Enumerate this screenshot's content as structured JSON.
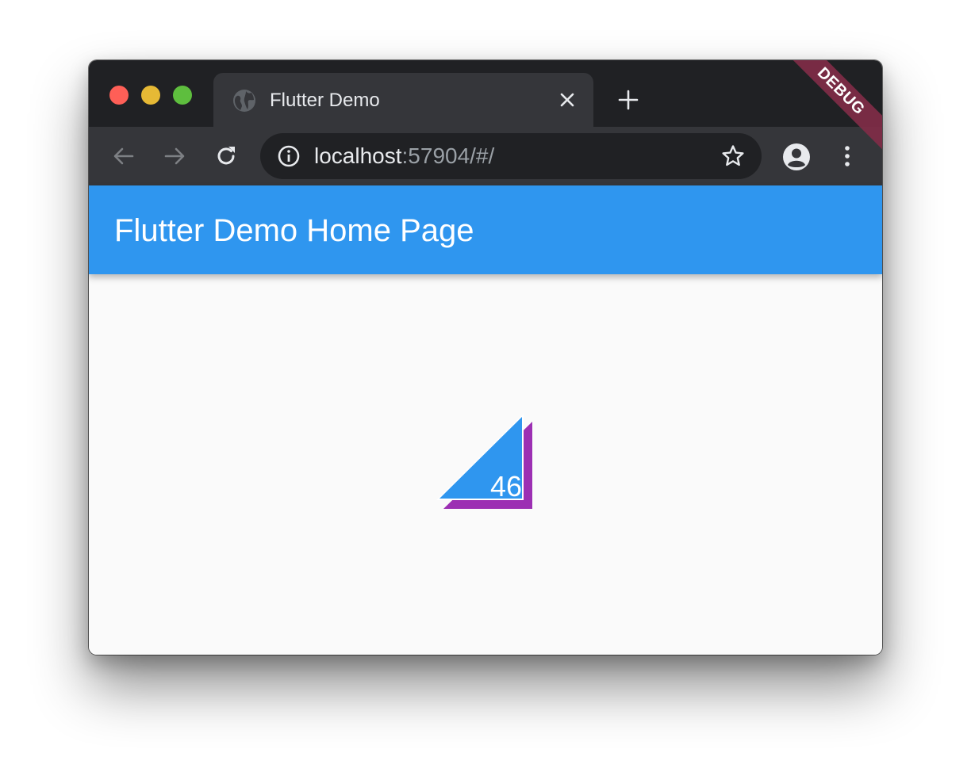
{
  "browser": {
    "tab": {
      "title": "Flutter Demo"
    },
    "address": {
      "host": "localhost",
      "rest": ":57904/#/"
    }
  },
  "app": {
    "title": "Flutter Demo Home Page",
    "debug_banner": "DEBUG",
    "counter": "46",
    "colors": {
      "primary": "#2f96ef",
      "shadow_triangle": "#9c2fb3",
      "background": "#fafafa"
    }
  }
}
